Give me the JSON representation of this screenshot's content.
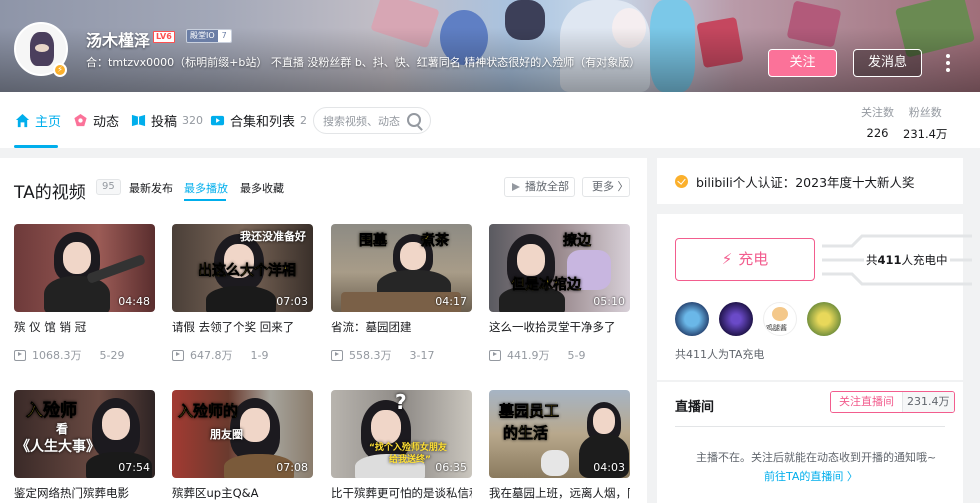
{
  "profile": {
    "username": "汤木槿泽",
    "level": "LV6",
    "medal_name": "殿堂IO",
    "medal_level": "7",
    "sign": "合：tmtzvx0000（标明前缀+b站）  不直播 没粉丝群 b、抖、快、红薯同名 精神状态很好的入殓师（有对象版）",
    "follow_label": "关注",
    "message_label": "发消息"
  },
  "nav": {
    "home": "主页",
    "dynamic": "动态",
    "posts": "投稿",
    "posts_count": "320",
    "collections": "合集和列表",
    "collections_count": "2",
    "search_placeholder": "搜索视频、动态"
  },
  "stats": {
    "following_label": "关注数",
    "following_value": "226",
    "fans_label": "粉丝数",
    "fans_value": "231.4万"
  },
  "videos_section": {
    "title": "TA的视频",
    "count": "95",
    "tabs": [
      "最新发布",
      "最多播放",
      "最多收藏"
    ],
    "active_tab": "最多播放",
    "play_all": "播放全部",
    "more": "更多 〉"
  },
  "videos": [
    {
      "title": "殡 仪 馆 销 冠",
      "duration": "04:48",
      "views": "1068.3万",
      "date": "5-29",
      "caption": ""
    },
    {
      "title": "请假 去领了个奖 回来了",
      "duration": "07:03",
      "views": "647.8万",
      "date": "1-9",
      "caption": "我还没准备好",
      "caption2": "出这么大个洋相"
    },
    {
      "title": "省流：墓园团建",
      "duration": "04:17",
      "views": "558.3万",
      "date": "3-17",
      "caption": "围墓",
      "caption2": "煮茶"
    },
    {
      "title": "这么一收拾灵堂干净多了",
      "duration": "05:10",
      "views": "441.9万",
      "date": "5-9",
      "caption": "撩边",
      "caption2": "但是冰棺边"
    },
    {
      "title": "鉴定网络热门殡葬电影",
      "duration": "07:54",
      "views": "",
      "date": "",
      "caption": "入殓师",
      "caption2": "看",
      "caption3": "《人生大事》"
    },
    {
      "title": "殡葬区up主Q&A",
      "duration": "07:08",
      "views": "",
      "date": "",
      "caption": "入殓师的",
      "caption2": "朋友圈"
    },
    {
      "title": "比干殡葬更可怕的是谈私信和",
      "duration": "06:35",
      "views": "",
      "date": "",
      "caption": "?",
      "caption2": "“找个入殓师女朋友",
      "caption3": "给我送终”"
    },
    {
      "title": "我在墓园上班，远离人烟，同",
      "duration": "04:03",
      "views": "",
      "date": "",
      "caption": "墓园员工",
      "caption2": "的生活"
    }
  ],
  "certification": "bilibili个人认证：2023年度十大新人奖",
  "charge": {
    "button": "充电",
    "count_prefix": "共",
    "count": "411",
    "count_suffix": "人充电中",
    "supporter_label": "鸡腿酱",
    "note": "共411人为TA充电"
  },
  "live": {
    "title": "直播间",
    "follow_live": "关注直播间",
    "live_fans": "231.4万",
    "tip": "主播不在。关注后就能在动态收到开播的通知哦~",
    "link": "前往TA的直播间  〉"
  },
  "colors": {
    "accent": "#00aeec",
    "pink": "#fb7299",
    "charge": "#f25d8e"
  }
}
